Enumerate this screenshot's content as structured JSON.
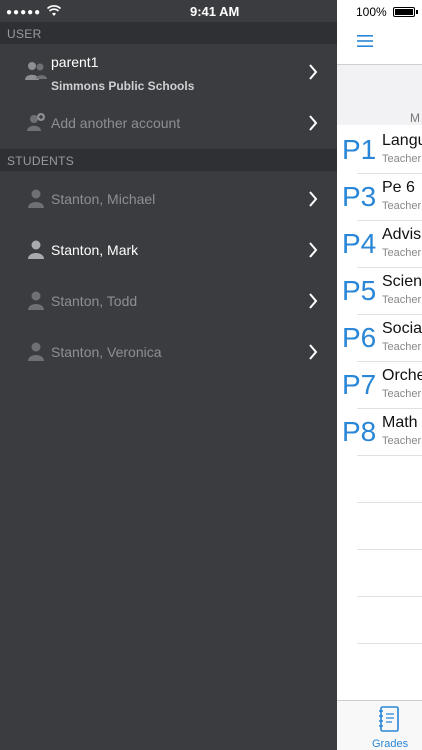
{
  "status_bar": {
    "signal": "●●●●●",
    "time": "9:41 AM",
    "battery": "100%"
  },
  "drawer": {
    "user_section": "USER",
    "account": {
      "name": "parent1",
      "school": "Simmons Public Schools"
    },
    "add_account": "Add another account",
    "students_section": "STUDENTS",
    "students": [
      {
        "name": "Stanton, Michael"
      },
      {
        "name": "Stanton, Mark"
      },
      {
        "name": "Stanton, Todd"
      },
      {
        "name": "Stanton, Veronica"
      }
    ]
  },
  "main": {
    "header_partial": "M",
    "courses": [
      {
        "period": "P1",
        "name": "Langu",
        "teacher": "Teacher"
      },
      {
        "period": "P3",
        "name": "Pe 6",
        "teacher": "Teacher"
      },
      {
        "period": "P4",
        "name": "Advis",
        "teacher": "Teacher"
      },
      {
        "period": "P5",
        "name": "Scien",
        "teacher": "Teacher"
      },
      {
        "period": "P6",
        "name": "Socia",
        "teacher": "Teacher"
      },
      {
        "period": "P7",
        "name": "Orche",
        "teacher": "Teacher"
      },
      {
        "period": "P8",
        "name": "Math",
        "teacher": "Teacher"
      }
    ],
    "tab_label": "Grades"
  },
  "colors": {
    "accent": "#2a86d6",
    "drawer_bg": "#3b3c3f",
    "section_bg": "#2f3033"
  }
}
